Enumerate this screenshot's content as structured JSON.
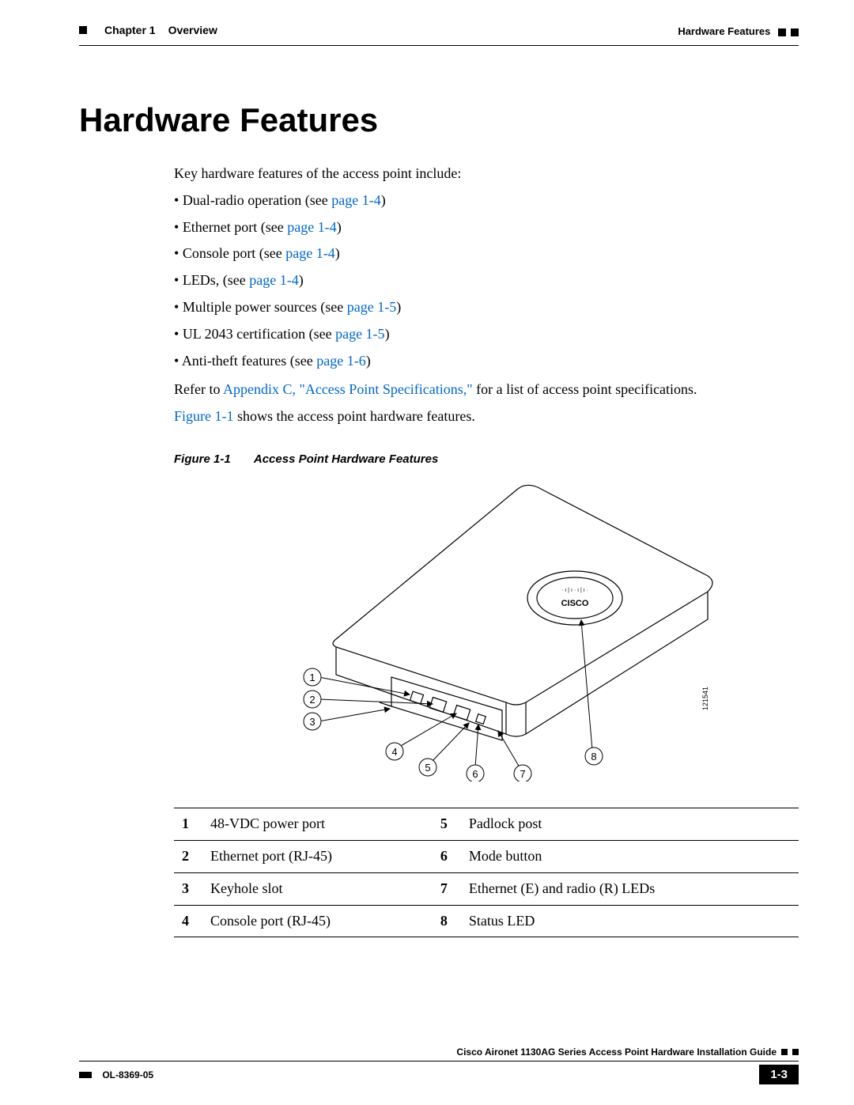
{
  "header": {
    "chapter": "Chapter 1",
    "chapter_title": "Overview",
    "section_right": "Hardware Features"
  },
  "heading": "Hardware Features",
  "intro": "Key hardware features of the access point include:",
  "bullets": [
    {
      "prefix": "Dual-radio operation (see ",
      "link": "page 1-4",
      "suffix": ")"
    },
    {
      "prefix": "Ethernet port (see ",
      "link": "page 1-4",
      "suffix": ")"
    },
    {
      "prefix": "Console port (see ",
      "link": "page 1-4",
      "suffix": ")"
    },
    {
      "prefix": "LEDs, (see ",
      "link": "page 1-4",
      "suffix": ")"
    },
    {
      "prefix": "Multiple power sources (see ",
      "link": "page 1-5",
      "suffix": ")"
    },
    {
      "prefix": "UL 2043 certification (see ",
      "link": "page 1-5",
      "suffix": ")"
    },
    {
      "prefix": "Anti-theft features (see ",
      "link": "page 1-6",
      "suffix": ")"
    }
  ],
  "para1_prefix": "Refer to ",
  "para1_link": "Appendix C, \"Access Point Specifications,\"",
  "para1_suffix": " for a list of access point specifications.",
  "para2_link": "Figure 1-1",
  "para2_suffix": " shows the access point hardware features.",
  "figure_label": "Figure 1-1",
  "figure_title": "Access Point Hardware Features",
  "figure_drawing_number": "121541",
  "callouts": [
    "1",
    "2",
    "3",
    "4",
    "5",
    "6",
    "7",
    "8"
  ],
  "table": [
    [
      "1",
      "48-VDC power port",
      "5",
      "Padlock post"
    ],
    [
      "2",
      "Ethernet port (RJ-45)",
      "6",
      "Mode button"
    ],
    [
      "3",
      "Keyhole slot",
      "7",
      "Ethernet (E) and radio (R) LEDs"
    ],
    [
      "4",
      "Console port (RJ-45)",
      "8",
      "Status LED"
    ]
  ],
  "footer": {
    "book_title": "Cisco Aironet 1130AG Series Access Point Hardware Installation Guide",
    "doc_id": "OL-8369-05",
    "page_number": "1-3"
  }
}
